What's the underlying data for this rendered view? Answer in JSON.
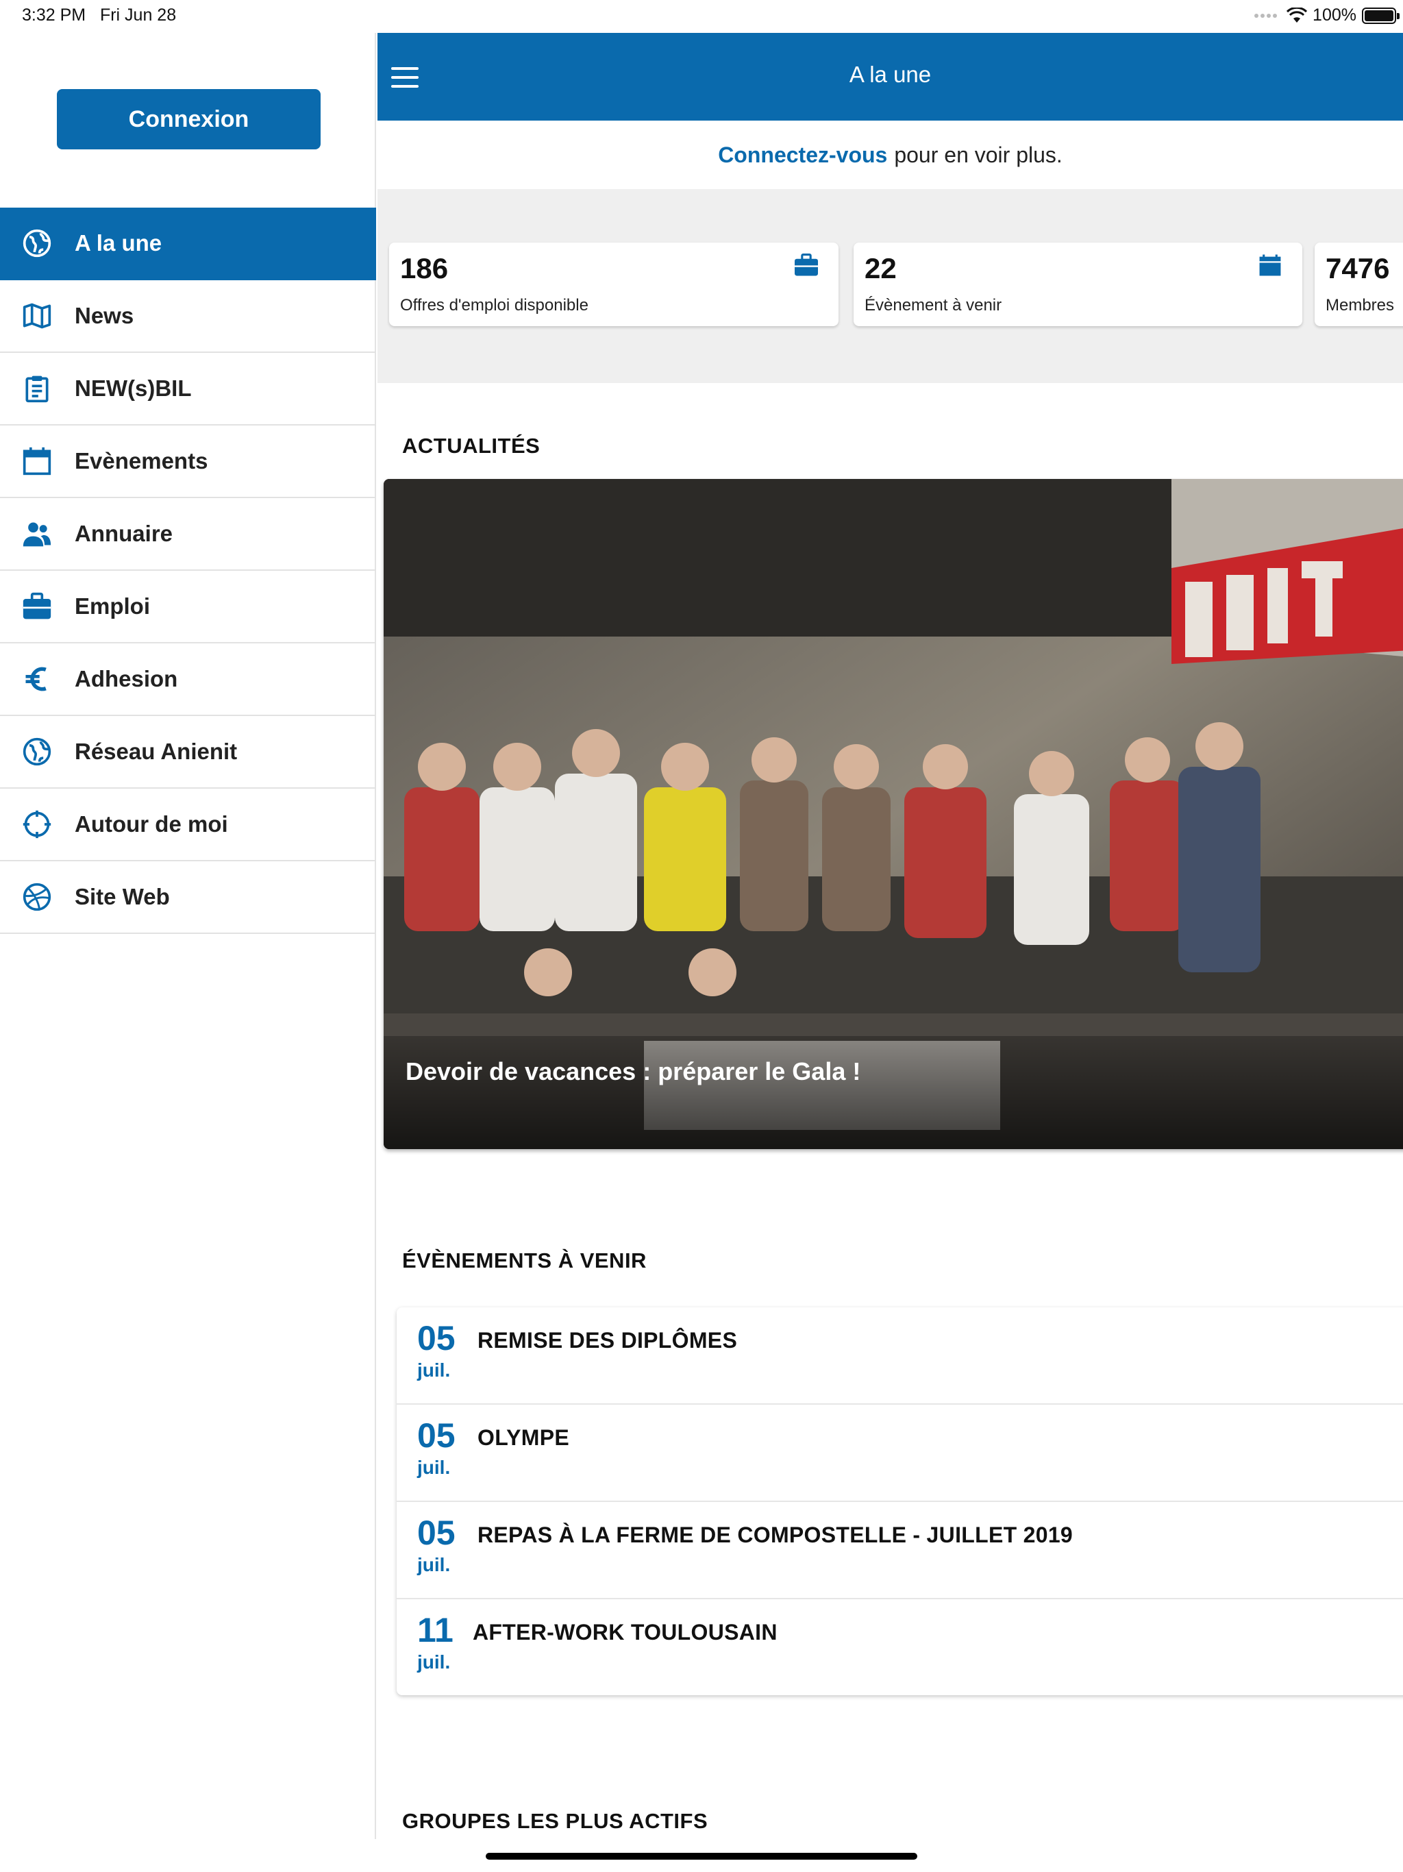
{
  "status_bar": {
    "time": "3:32 PM",
    "date": "Fri Jun 28",
    "battery": "100%"
  },
  "sidebar": {
    "login_label": "Connexion",
    "items": [
      {
        "label": "A la une",
        "icon": "globe-icon",
        "active": true
      },
      {
        "label": "News",
        "icon": "map-icon"
      },
      {
        "label": "NEW(s)BIL",
        "icon": "clipboard-icon"
      },
      {
        "label": "Evènements",
        "icon": "calendar-icon"
      },
      {
        "label": "Annuaire",
        "icon": "people-icon"
      },
      {
        "label": "Emploi",
        "icon": "briefcase-icon"
      },
      {
        "label": "Adhesion",
        "icon": "euro-icon"
      },
      {
        "label": "Réseau Anienit",
        "icon": "globe-icon"
      },
      {
        "label": "Autour de moi",
        "icon": "crosshair-icon"
      },
      {
        "label": "Site Web",
        "icon": "dribbble-icon"
      }
    ]
  },
  "header": {
    "title": "A la une"
  },
  "login_prompt": {
    "link": "Connectez-vous",
    "text": "pour en voir plus."
  },
  "stats": [
    {
      "value": "186",
      "label": "Offres d'emploi disponible",
      "icon": "briefcase-icon"
    },
    {
      "value": "22",
      "label": "Évènement à venir",
      "icon": "calendar-icon"
    },
    {
      "value": "7476",
      "label": "Membres",
      "icon": "people-icon"
    }
  ],
  "sections": {
    "news": "ACTUALITÉS",
    "events": "ÉVÈNEMENTS À VENIR",
    "groups": "GROUPES LES PLUS ACTIFS"
  },
  "news": [
    {
      "title": "Devoir de vacances : préparer le Gala !"
    }
  ],
  "events": [
    {
      "day": "05",
      "month": "juil.",
      "title": "REMISE DES DIPLÔMES"
    },
    {
      "day": "05",
      "month": "juil.",
      "title": "OLYMPE"
    },
    {
      "day": "05",
      "month": "juil.",
      "title": "REPAS À LA FERME DE COMPOSTELLE - JUILLET 2019"
    },
    {
      "day": "11",
      "month": "juil.",
      "title": "AFTER-WORK TOULOUSAIN"
    }
  ],
  "colors": {
    "brand": "#0a6aad",
    "band": "#efefef"
  }
}
